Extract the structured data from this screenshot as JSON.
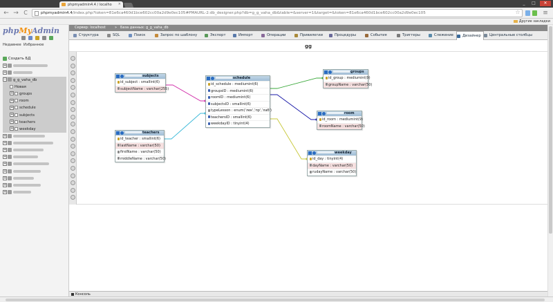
{
  "browser": {
    "tab_title": "phpmyadmin4.4 / localho",
    "tab_close": "×",
    "url_host": "phpmyadmin4.4",
    "url_rest": "/index.php?token=81e6ca460d1bce602cc00a2d9e0ec105#PMAURL-2:db_designer.php?db=g_g_vaha_db&table=&server=1&target=&token=81e6ca460d1bce602cc00a2d9e0ec105",
    "back": "←",
    "forward": "→",
    "reload": "C",
    "star": "☆",
    "menu": "≡",
    "other_bookmarks": "Другие закладки",
    "win_min": "_",
    "win_max": "□",
    "win_close": "✕"
  },
  "nav": {
    "logo_php": "php",
    "logo_my": "My",
    "logo_admin": "Admin",
    "recent": "Недавнее",
    "favorites": "Избранное",
    "create_db": "Создать БД",
    "current_db": "g_g_vaha_db",
    "new_item": "Новая",
    "tables": [
      "groups",
      "room",
      "schedule",
      "subjects",
      "teachers",
      "weekday"
    ]
  },
  "header": {
    "crumb_server": "Сервер: localhost",
    "crumb_sep1": "»",
    "crumb_db": "База данных: g_g_vaha_db",
    "title": "gg"
  },
  "menu": [
    {
      "label": "Структура",
      "color": "#7a8fb3"
    },
    {
      "label": "SQL",
      "color": "#8a8a8a"
    },
    {
      "label": "Поиск",
      "color": "#6f8fbf"
    },
    {
      "label": "Запрос по шаблону",
      "color": "#c58a3a"
    },
    {
      "label": "Экспорт",
      "color": "#5a9a5a"
    },
    {
      "label": "Импорт",
      "color": "#5a7aaa"
    },
    {
      "label": "Операции",
      "color": "#8a6a9a"
    },
    {
      "label": "Привилегии",
      "color": "#aa8a3a"
    },
    {
      "label": "Процедуры",
      "color": "#6a6a9a"
    },
    {
      "label": "События",
      "color": "#9a6a3a"
    },
    {
      "label": "Триггеры",
      "color": "#7a7a7a"
    },
    {
      "label": "Слежение",
      "color": "#5a8aaa"
    },
    {
      "label": "Дизайнер",
      "color": "#3a6a9a"
    },
    {
      "label": "Центральные столбцы",
      "color": "#7a8a9a"
    }
  ],
  "designer": {
    "tables": [
      {
        "name": "subjects",
        "columns": [
          {
            "text": "id_subject : smallint(6)",
            "kind": "pk"
          },
          {
            "text": "subjectName : varchar(255)",
            "kind": "hl"
          }
        ]
      },
      {
        "name": "teachers",
        "columns": [
          {
            "text": "id_teacher : smallint(6)",
            "kind": "pk"
          },
          {
            "text": "lastName : varchar(50)",
            "kind": "hl"
          },
          {
            "text": "firstName : varchar(50)",
            "kind": ""
          },
          {
            "text": "middleName : varchar(50)",
            "kind": ""
          }
        ]
      },
      {
        "name": "schedule",
        "columns": [
          {
            "text": "id_schedule : mediumint(6)",
            "kind": "pk"
          },
          {
            "text": "groupsID : mediumint(6)",
            "kind": "fk"
          },
          {
            "text": "roomID : mediumint(6)",
            "kind": "fk"
          },
          {
            "text": "subjectsID : smallint(6)",
            "kind": "fk"
          },
          {
            "text": "typeLesson : enum('лек','пр','лаб')",
            "kind": ""
          },
          {
            "text": "teachersID : smallint(6)",
            "kind": "fk"
          },
          {
            "text": "weekdayID : tinyint(4)",
            "kind": "fk"
          }
        ]
      },
      {
        "name": "groups",
        "columns": [
          {
            "text": "id_group : mediumint(9)",
            "kind": "pk"
          },
          {
            "text": "groupName : varchar(50)",
            "kind": "hl"
          }
        ]
      },
      {
        "name": "room",
        "columns": [
          {
            "text": "id_room : mediumint(9)",
            "kind": "pk"
          },
          {
            "text": "roomName : varchar(50)",
            "kind": "hl"
          }
        ]
      },
      {
        "name": "weekday",
        "columns": [
          {
            "text": "id_day : tinyint(4)",
            "kind": "pk"
          },
          {
            "text": "dayName : varchar(50)",
            "kind": "hl"
          },
          {
            "text": "rudayName : varchar(50)",
            "kind": ""
          }
        ]
      }
    ],
    "relation_colors": {
      "subjects": "#d02aa8",
      "teachers": "#38b8d8",
      "groups": "#3aa83a",
      "room": "#1a1aa8",
      "weekday": "#c8c83a"
    }
  },
  "console": {
    "label": "Консоль"
  }
}
